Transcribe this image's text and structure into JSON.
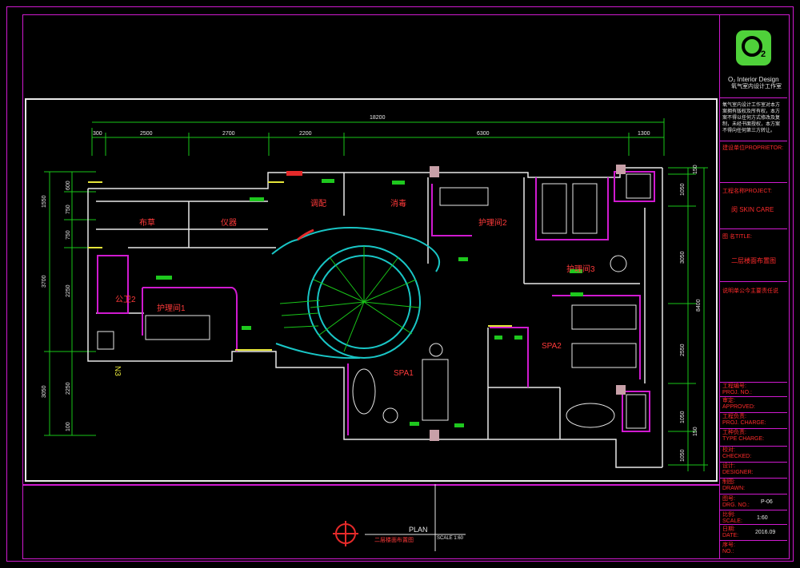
{
  "logo": {
    "mark": "O",
    "sub": "2",
    "name": "O₂ Interior Design",
    "cn_name": "氧气室内设计工作室"
  },
  "notes": "氧气室内设计工作室对本方案拥有版权及所有权，本方案不得以任何方式修改及复制，未经书面授权，本方案不得向任何第三方转让。",
  "title_block": {
    "proprietor_label": "建设单位PROPRIETOR:",
    "project_label": "工程名称PROJECT:",
    "project_value": "闵 SKIN CARE",
    "title_label": "图 名TITLE:",
    "title_value": "二层楼面布置图",
    "note_red": "说明单公今主要责任说",
    "proj_no": "工程编号:\nPROJ. NO.:",
    "approved": "审定:\nAPPROVED:",
    "proj_charge": "工程负责:\nPROJ. CHARGE:",
    "type_charge": "工种负责:\nTYPE CHARGE:",
    "checked": "校对:\nCHECKED:",
    "designer": "设计:\nDESIGNER:",
    "drawn": "制图:\nDRAWN:",
    "drg_no_label": "图号:\nDRG. NO.:",
    "drg_no_value": "P-06",
    "scale_label": "比例:\nSCALE:",
    "scale_value": "1:60",
    "date_label": "日期:\nDATE:",
    "date_value": "2016.09",
    "no_label": "序号:\nNO.:"
  },
  "plan": {
    "caption": "PLAN",
    "caption_cn": "二层楼面布置图",
    "scale": "SCALE 1:60",
    "north": "N3"
  },
  "rooms": {
    "r1": "布草",
    "r2": "仪器",
    "r3": "调配",
    "r4": "消毒",
    "r5": "护理间2",
    "r6": "护理间3",
    "r7": "公卫2",
    "r8": "护理间1",
    "r9": "SPA1",
    "r10": "SPA2"
  },
  "dims_top": {
    "total": "18200",
    "d1": "300",
    "d2": "2500",
    "d3": "2700",
    "d4": "2200",
    "d5": "6300",
    "d6": "1300"
  },
  "dims_left": {
    "l1": "1550",
    "l2": "600",
    "l3": "750",
    "l4": "750",
    "l5": "3700",
    "l6": "2250",
    "l7": "3050",
    "l8": "2250",
    "l9": "100"
  },
  "dims_right": {
    "r1": "150",
    "r2": "1050",
    "r3": "3050",
    "r4": "8400",
    "r5": "2550",
    "r6": "1050",
    "r7": "1050",
    "r8": "150"
  },
  "colors": {
    "frame": "#d01ad0",
    "wall": "#e8e8e8",
    "stair": "#19c6c6",
    "fixture": "#1ec81e",
    "text_red": "#ff2b2b",
    "stub_pink": "#c8a0a8"
  }
}
